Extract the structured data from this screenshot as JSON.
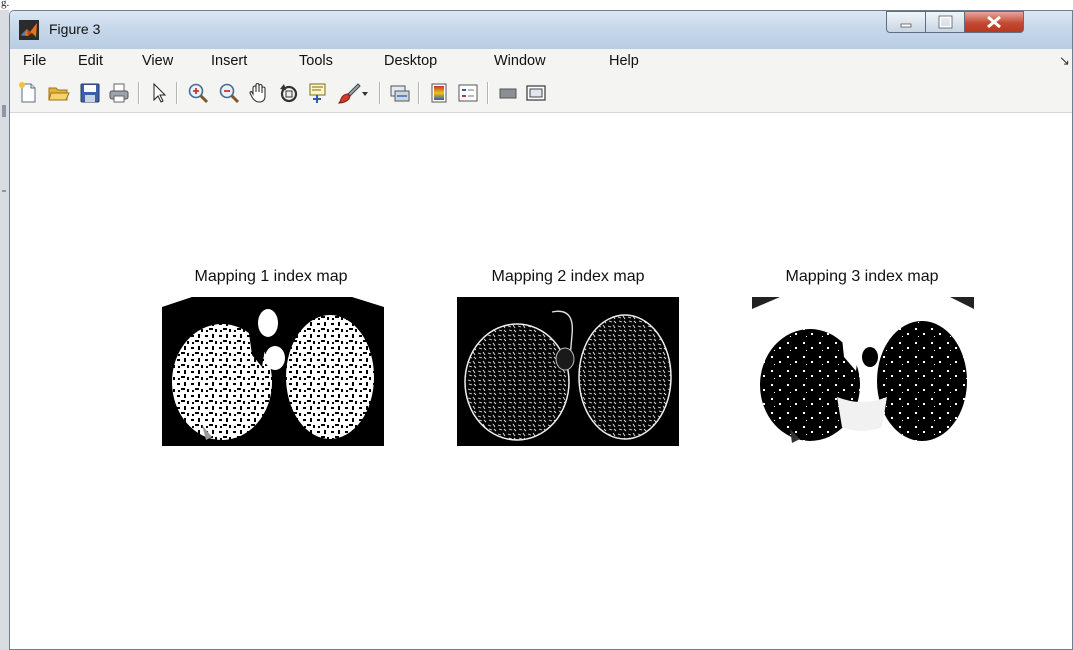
{
  "window": {
    "title": "Figure 3",
    "caption_fragment": "g."
  },
  "menu": [
    "File",
    "Edit",
    "View",
    "Insert",
    "Tools",
    "Desktop",
    "Window",
    "Help"
  ],
  "menu_overflow": "↘",
  "toolbar_icons": [
    "new-figure-icon",
    "open-file-icon",
    "save-icon",
    "print-icon",
    "pointer-icon",
    "zoom-in-icon",
    "zoom-out-icon",
    "pan-hand-icon",
    "rotate-3d-icon",
    "data-cursor-icon",
    "brush-icon",
    "brush-dropdown-icon",
    "link-plot-icon",
    "colorbar-icon",
    "legend-icon",
    "hide-plot-tools-icon",
    "show-plot-tools-icon"
  ],
  "axes": [
    {
      "title": "Mapping 1 index map",
      "style": "white-on-black"
    },
    {
      "title": "Mapping 2 index map",
      "style": "edges-on-black"
    },
    {
      "title": "Mapping 3 index map",
      "style": "black-on-white"
    }
  ],
  "colors": {
    "titlebar": "#c7d8ea",
    "menubar": "#f4f4f2",
    "close": "#c44a33"
  }
}
